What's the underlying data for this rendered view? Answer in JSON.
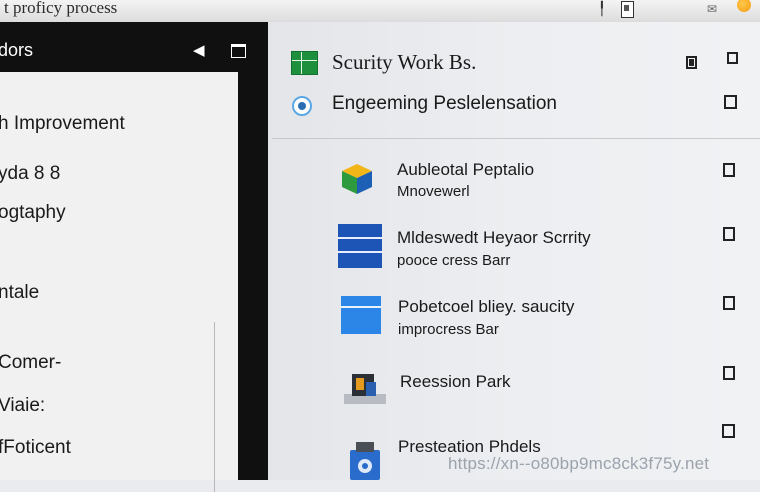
{
  "window": {
    "title": "t proficy process"
  },
  "left": {
    "header_label": "dors",
    "items": [
      "h Improvement",
      "yda 8 8",
      "ogtaphy",
      "ntale",
      "Comer-",
      "Viaie:",
      "fFoticent"
    ]
  },
  "right": {
    "header_rows": [
      {
        "label": "Scurity Work Bs.",
        "icon": "green-grid-icon"
      },
      {
        "label": "Engeeming Peslelensation",
        "icon": "target-icon"
      }
    ],
    "items": [
      {
        "line1": "Aubleotal Peptalio",
        "line2": "Mnovewerl",
        "icon": "cube-icon"
      },
      {
        "line1": "Mldeswedt Heyaor Scrrity",
        "line2": "pooce cress Barr",
        "icon": "blue-bars-icon"
      },
      {
        "line1": "Pobetcoel bliey. saucity",
        "line2": "improcress Bar",
        "icon": "blue-window-icon"
      },
      {
        "line1": "Reession Park",
        "line2": "",
        "icon": "toolbox-icon"
      },
      {
        "line1": "Presteation Phdels",
        "line2": "",
        "icon": "package-icon"
      }
    ]
  },
  "watermark": "https://xn--o80bp9mc8ck3f75y.net",
  "colors": {
    "accent_green": "#1e8f3c",
    "accent_blue": "#1c55b5",
    "dark_frame": "#101010"
  }
}
